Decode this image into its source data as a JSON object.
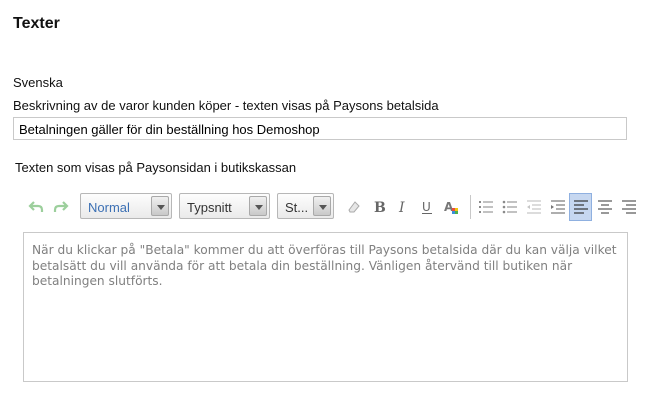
{
  "page": {
    "title": "Texter"
  },
  "language": {
    "label": "Svenska"
  },
  "description": {
    "label": "Beskrivning av de varor kunden köper - texten visas på Paysons betalsida",
    "value": "Betalningen gäller för din beställning hos Demoshop"
  },
  "checkout": {
    "label": "Texten som visas på Paysonsidan i butikskassan"
  },
  "toolbar": {
    "format_value": "Normal",
    "font_value": "Typsnitt",
    "size_value": "St...",
    "icons": [
      "undo-icon",
      "redo-icon",
      "remove-format-icon",
      "bold-icon",
      "italic-icon",
      "underline-icon",
      "text-color-icon",
      "ordered-list-icon",
      "unordered-list-icon",
      "outdent-icon",
      "indent-icon",
      "align-left-icon",
      "align-center-icon",
      "align-right-icon"
    ],
    "active_icon": "align-left-icon",
    "accent_color": "#3c70b4"
  },
  "editor": {
    "content": "När du klickar på \"Betala\" kommer du att överföras till Paysons betalsida där du kan välja vilket betalsätt du vill använda för att betala din beställning. Vänligen återvänd till butiken när betalningen slutförts."
  }
}
